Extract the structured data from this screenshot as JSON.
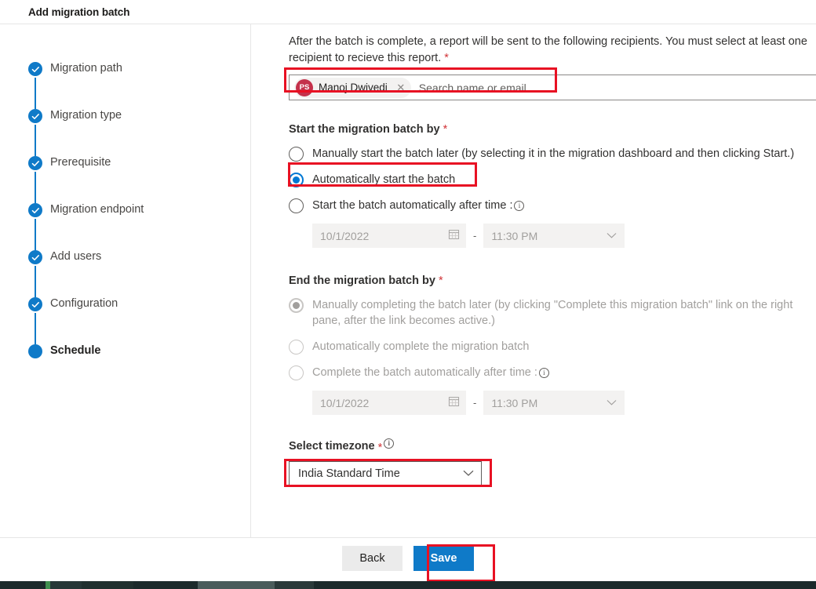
{
  "header": {
    "title": "Add migration batch"
  },
  "sidebar": {
    "items": [
      {
        "label": "Migration path",
        "state": "completed"
      },
      {
        "label": "Migration type",
        "state": "completed"
      },
      {
        "label": "Prerequisite",
        "state": "completed"
      },
      {
        "label": "Migration endpoint",
        "state": "completed"
      },
      {
        "label": "Add users",
        "state": "completed"
      },
      {
        "label": "Configuration",
        "state": "completed"
      },
      {
        "label": "Schedule",
        "state": "current"
      }
    ]
  },
  "content": {
    "intro": "After the batch is complete, a report will be sent to the following recipients. You must select at least one recipient to recieve this report.",
    "intro_required": "*",
    "recipient": {
      "avatar_initials": "PS",
      "avatar_color": "#c4314b",
      "name": "Manoj Dwivedi",
      "remove_icon": "close-icon",
      "placeholder": "Search name or email"
    },
    "start_section": {
      "heading": "Start the migration batch by",
      "required": "*",
      "options": [
        {
          "label": "Manually start the batch later (by selecting it in the migration dashboard and then clicking Start.)",
          "selected": false
        },
        {
          "label": "Automatically start the batch",
          "selected": true
        },
        {
          "label": "Start the batch automatically after time :",
          "selected": false,
          "info": true
        }
      ],
      "date_value": "10/1/2022",
      "date_icon": "calendar-icon",
      "separator": "-",
      "time_value": "11:30 PM",
      "time_icon": "chevron-down-icon"
    },
    "end_section": {
      "heading": "End the migration batch by",
      "required": "*",
      "disabled": true,
      "options": [
        {
          "label": "Manually completing the batch later (by clicking \"Complete this migration batch\" link on the right pane, after the link becomes active.)",
          "selected": true
        },
        {
          "label": "Automatically complete the migration batch",
          "selected": false
        },
        {
          "label": "Complete the batch automatically after time :",
          "selected": false,
          "info": true
        }
      ],
      "date_value": "10/1/2022",
      "date_icon": "calendar-icon",
      "separator": "-",
      "time_value": "11:30 PM",
      "time_icon": "chevron-down-icon"
    },
    "timezone": {
      "label": "Select timezone",
      "required": "*",
      "info_icon": "info-icon",
      "value": "India Standard Time",
      "chevron": "chevron-down-icon"
    }
  },
  "footer": {
    "back_label": "Back",
    "save_label": "Save"
  },
  "colors": {
    "accent": "#0078d4",
    "step_blue": "#0f7ac8",
    "highlight": "#e81123",
    "required_red": "#d13438",
    "save_blue": "#0f7ac8"
  }
}
